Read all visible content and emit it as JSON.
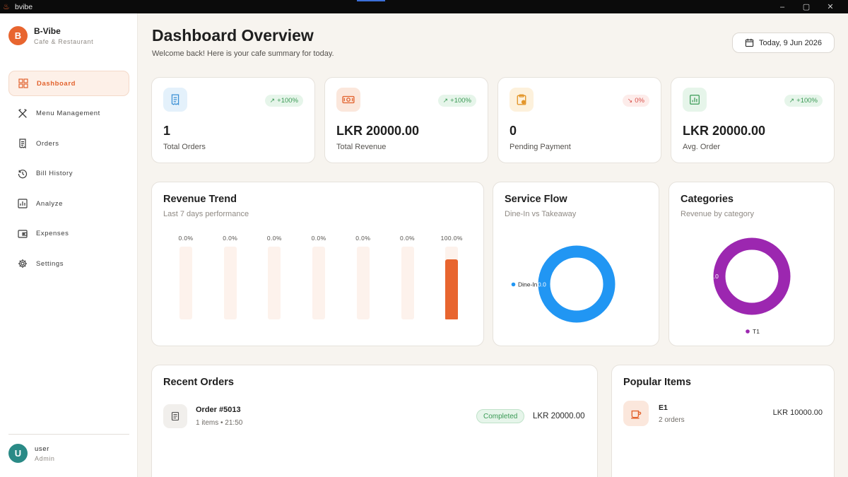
{
  "window": {
    "title": "bvibe",
    "minimize": "–",
    "maximize": "▢",
    "close": "✕"
  },
  "brand": {
    "initial": "B",
    "name": "B-Vibe",
    "subtitle": "Cafe & Restaurant"
  },
  "nav": [
    {
      "label": "Dashboard",
      "icon": "grid-icon",
      "active": true
    },
    {
      "label": "Menu Management",
      "icon": "utensils-icon",
      "active": false
    },
    {
      "label": "Orders",
      "icon": "receipt-icon",
      "active": false
    },
    {
      "label": "Bill History",
      "icon": "history-icon",
      "active": false
    },
    {
      "label": "Analyze",
      "icon": "chart-icon",
      "active": false
    },
    {
      "label": "Expenses",
      "icon": "wallet-icon",
      "active": false
    },
    {
      "label": "Settings",
      "icon": "gear-icon",
      "active": false
    }
  ],
  "user": {
    "initial": "U",
    "name": "user",
    "role": "Admin"
  },
  "header": {
    "title": "Dashboard Overview",
    "subtitle": "Welcome back! Here is your cafe summary for today.",
    "date": "Today, 9 Jun 2026"
  },
  "stats": [
    {
      "value": "1",
      "label": "Total Orders",
      "badge": "+100%",
      "trend": "up",
      "icon": "receipt-icon",
      "icon_bg": "#e4f1fb",
      "icon_color": "#3a8fd4"
    },
    {
      "value": "LKR 20000.00",
      "label": "Total Revenue",
      "badge": "+100%",
      "trend": "up",
      "icon": "cash-icon",
      "icon_bg": "#fbe7dc",
      "icon_color": "#e2622d"
    },
    {
      "value": "0",
      "label": "Pending Payment",
      "badge": "0%",
      "trend": "down",
      "icon": "clipboard-icon",
      "icon_bg": "#fdf1dc",
      "icon_color": "#e3962b"
    },
    {
      "value": "LKR 20000.00",
      "label": "Avg. Order",
      "badge": "+100%",
      "trend": "up",
      "icon": "chart-icon",
      "icon_bg": "#e6f5ea",
      "icon_color": "#3a9a55"
    }
  ],
  "revenue_card": {
    "title": "Revenue Trend",
    "subtitle": "Last 7 days performance"
  },
  "service_card": {
    "title": "Service Flow",
    "subtitle": "Dine-In vs Takeaway",
    "slice_label": "0.0"
  },
  "category_card": {
    "title": "Categories",
    "subtitle": "Revenue by category",
    "slice_label": "0.0"
  },
  "chart_data": [
    {
      "type": "bar",
      "title": "Revenue Trend",
      "data_labels": [
        "0.0%",
        "0.0%",
        "0.0%",
        "0.0%",
        "0.0%",
        "0.0%",
        "100.0%"
      ],
      "values": [
        0,
        0,
        0,
        0,
        0,
        0,
        100
      ],
      "ylim": [
        0,
        100
      ],
      "bar_color": "#e8652f",
      "track_color": "#fdf2ec"
    },
    {
      "type": "pie",
      "title": "Service Flow",
      "slices": [
        {
          "label": "Dine-In",
          "value": 100,
          "color": "#2196f3"
        }
      ],
      "legend": "left"
    },
    {
      "type": "pie",
      "title": "Categories",
      "slices": [
        {
          "label": "T1",
          "value": 100,
          "color": "#9c27b0"
        }
      ],
      "legend": "bottom"
    }
  ],
  "recent_orders": {
    "title": "Recent Orders",
    "items": [
      {
        "title": "Order #5013",
        "meta": "1 items • 21:50",
        "status": "Completed",
        "amount": "LKR 20000.00"
      }
    ]
  },
  "popular_items": {
    "title": "Popular Items",
    "items": [
      {
        "name": "E1",
        "meta": "2 orders",
        "amount": "LKR 10000.00"
      }
    ]
  }
}
